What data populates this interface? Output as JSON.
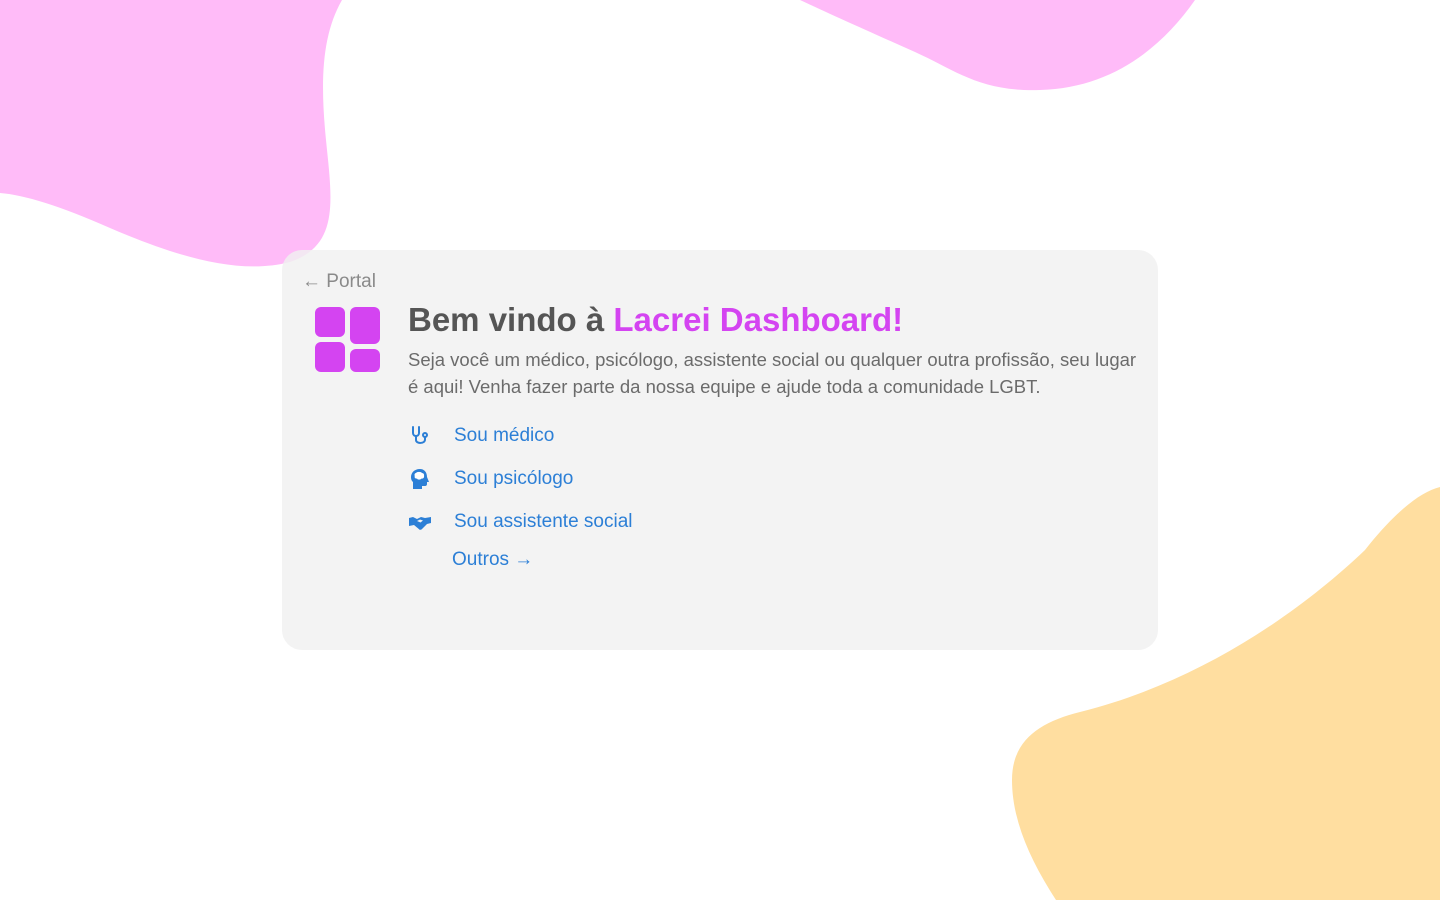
{
  "colors": {
    "background": "#ffffff",
    "card": "#f2f2f2",
    "accent": "#d444f1",
    "link": "#2c7fd6",
    "heading": "#555555",
    "text": "#6b6b6b",
    "blob_pink": "#ffbbf8",
    "blob_yellow": "#ffdea0"
  },
  "nav": {
    "back_label": "← Portal"
  },
  "header": {
    "logo_icon": "dashboard-grid-icon",
    "title_prefix": "Bem vindo à ",
    "title_highlight": "Lacrei Dashboard!"
  },
  "intro": {
    "text": "Seja você um médico, psicólogo, assistente social ou qualquer outra profissão, seu lugar é aqui! Venha fazer parte da nossa equipe e ajude toda a comunidade LGBT."
  },
  "options": [
    {
      "label": "Sou médico",
      "icon": "stethoscope-icon"
    },
    {
      "label": "Sou psicólogo",
      "icon": "head-brain-icon"
    },
    {
      "label": "Sou assistente social",
      "icon": "handshake-icon"
    }
  ],
  "others_label": "Outros →"
}
